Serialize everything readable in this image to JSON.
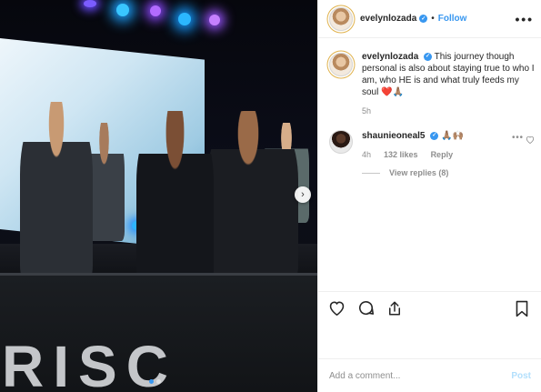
{
  "post": {
    "username": "evelynlozada",
    "verified_badge": "verified-check-icon",
    "follow_label": "Follow",
    "bullet": "•",
    "more_icon": "more-horizontal-icon",
    "photo_letters": "RISC",
    "carousel": {
      "current": 1,
      "total": 2
    }
  },
  "caption": {
    "username": "evelynlozada",
    "text": "This journey though personal is also about staying true to who I am, who HE is and what truly feeds my soul",
    "emoji": "❤️🙏🏽",
    "time": "5h"
  },
  "comments": [
    {
      "username": "shaunieoneal5",
      "text": "🙏🏽🙌🏽",
      "time": "4h",
      "likes": "132 likes",
      "reply_label": "Reply",
      "view_replies": "View replies (8)"
    }
  ],
  "actions": {
    "like_icon": "heart-icon",
    "comment_icon": "comment-icon",
    "share_icon": "share-icon",
    "save_icon": "bookmark-icon"
  },
  "composer": {
    "placeholder": "Add a comment...",
    "post_label": "Post"
  },
  "colors": {
    "accent": "#3897f0",
    "post_disabled": "#b2dffc",
    "muted": "#8e8e8e"
  }
}
